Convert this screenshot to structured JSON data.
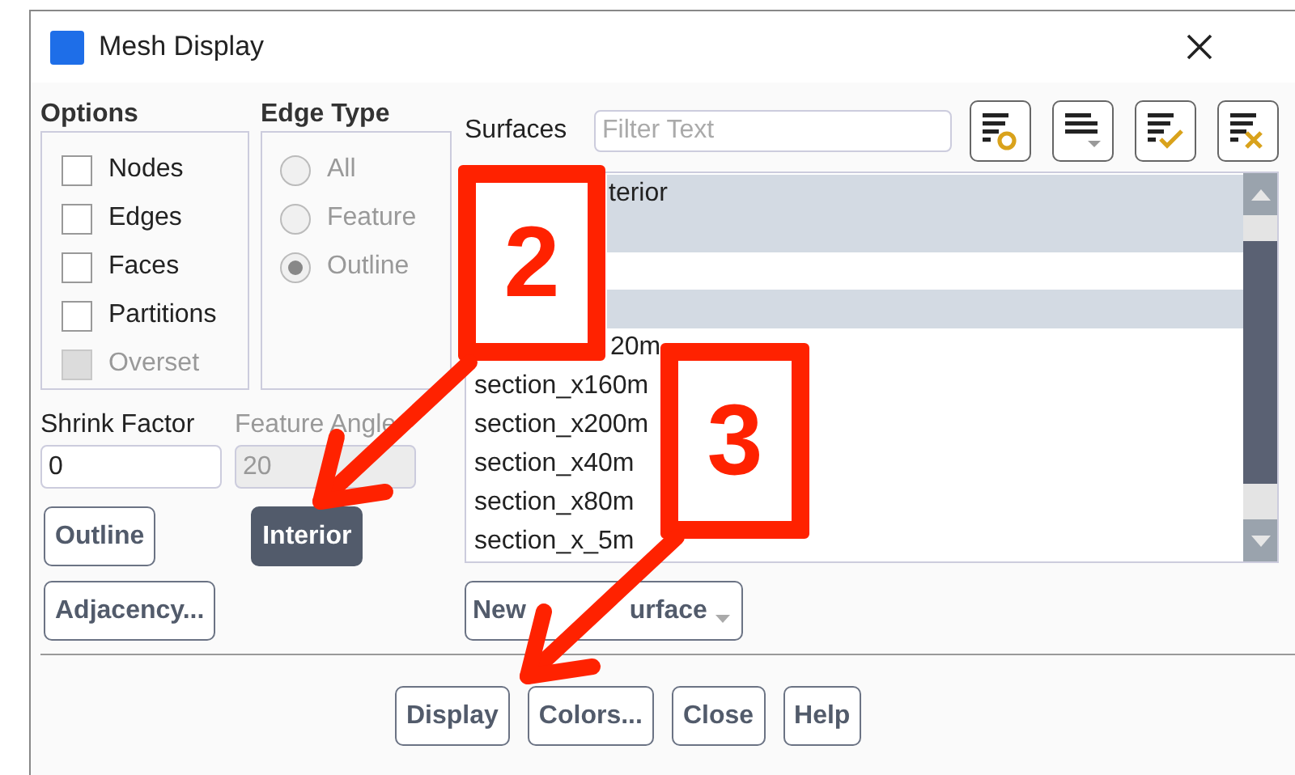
{
  "window": {
    "title": "Mesh Display"
  },
  "options": {
    "label": "Options",
    "items": [
      {
        "label": "Nodes",
        "checked": false,
        "disabled": false
      },
      {
        "label": "Edges",
        "checked": false,
        "disabled": false
      },
      {
        "label": "Faces",
        "checked": false,
        "disabled": false
      },
      {
        "label": "Partitions",
        "checked": false,
        "disabled": false
      },
      {
        "label": "Overset",
        "checked": false,
        "disabled": true
      }
    ]
  },
  "edge_type": {
    "label": "Edge Type",
    "items": [
      {
        "label": "All",
        "selected": false
      },
      {
        "label": "Feature",
        "selected": false
      },
      {
        "label": "Outline",
        "selected": true
      }
    ]
  },
  "surfaces": {
    "label": "Surfaces",
    "filter_placeholder": "Filter Text",
    "toolbar": [
      {
        "kind": "circle"
      },
      {
        "kind": "caret"
      },
      {
        "kind": "check"
      },
      {
        "kind": "cross"
      }
    ],
    "rows": [
      {
        "text": "terior",
        "selected": true
      },
      {
        "selected": true
      },
      {
        "selected": false
      },
      {
        "selected": true
      },
      {
        "text": "20m",
        "selected": false
      },
      {
        "text": "section_x160m",
        "selected": false
      },
      {
        "text": "section_x200m",
        "selected": false
      },
      {
        "text": "section_x40m",
        "selected": false
      },
      {
        "text": "section_x80m",
        "selected": false
      },
      {
        "text": "section_x_5m",
        "selected": false
      }
    ],
    "new_surface_button": {
      "words": [
        "New",
        "urface"
      ]
    }
  },
  "shrink_factor": {
    "label": "Shrink Factor",
    "value": "0"
  },
  "feature_angle": {
    "label": "Feature Angle",
    "value": "20",
    "disabled": true
  },
  "mode_buttons": [
    {
      "label": "Outline",
      "selected": false
    },
    {
      "label": "Interior",
      "selected": true
    }
  ],
  "adjacency_button": "Adjacency...",
  "buttons": [
    "Display",
    "Colors...",
    "Close",
    "Help"
  ],
  "annotations": [
    {
      "label": "2"
    },
    {
      "label": "3"
    }
  ]
}
